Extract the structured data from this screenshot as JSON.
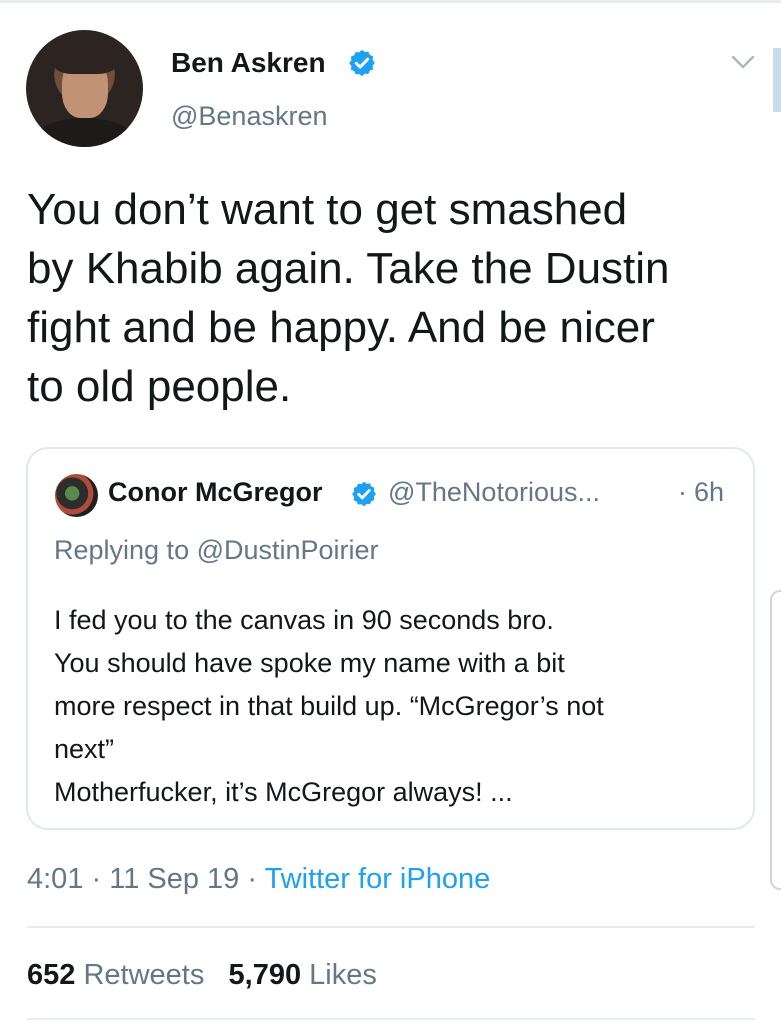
{
  "tweet": {
    "author": {
      "display_name": "Ben Askren",
      "handle": "@Benaskren",
      "avatar_icon": "profile-photo",
      "verified_icon": "verified-badge-icon"
    },
    "text": "You don’t want to get smashed\nby Khabib again.  Take the Dustin\nfight and be happy.  And be nicer\nto old people.",
    "quoted": {
      "author": {
        "display_name": "Conor McGregor",
        "handle": "@TheNotorious...",
        "verified_icon": "verified-badge-icon"
      },
      "time_sep": "·",
      "time": "6h",
      "replying_to": "Replying to @DustinPoirier",
      "text": "I fed you to the canvas in 90 seconds bro.\nYou should have spoke my name with a bit\nmore respect in that build up. “McGregor’s not\nnext”\nMotherfucker, it’s McGregor always! ..."
    },
    "meta": {
      "time": "4:01",
      "sep1": " · ",
      "date": "11 Sep 19",
      "sep2": " · ",
      "source": "Twitter for iPhone"
    },
    "stats": {
      "retweets_count": "652",
      "retweets_label": "Retweets",
      "likes_count": "5,790",
      "likes_label": "Likes"
    }
  },
  "colors": {
    "primary_text": "#14171a",
    "secondary_text": "#657786",
    "link": "#1da1f2",
    "verified": "#1da1f2",
    "border": "#e1e8ed"
  }
}
